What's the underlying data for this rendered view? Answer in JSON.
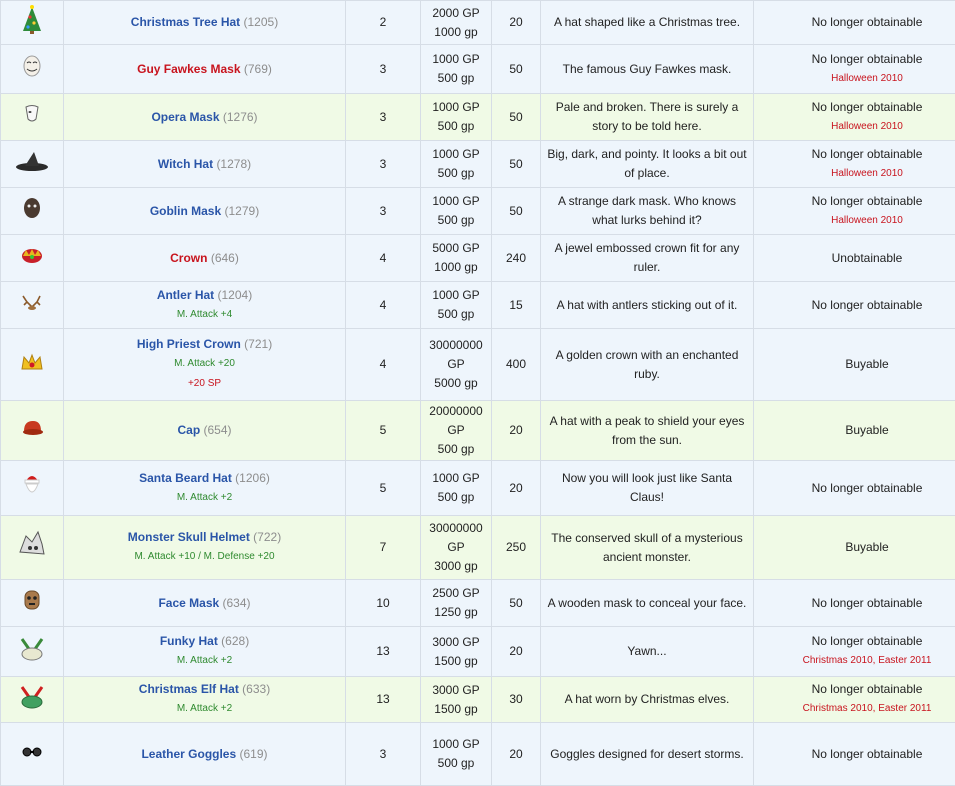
{
  "items": [
    {
      "icon": "christmas-tree-hat-icon",
      "name": "Christmas Tree Hat",
      "id": "(1205)",
      "level": "2",
      "gp": "2000 GP",
      "gp_sell": "1000 gp",
      "sell": "20",
      "desc": "A hat shaped like a Christmas tree.",
      "obtain": "No longer obtainable",
      "note": "",
      "stats": []
    },
    {
      "icon": "guy-fawkes-mask-icon",
      "name": "Guy Fawkes Mask",
      "id": "(769)",
      "level": "3",
      "gp": "1000 GP",
      "gp_sell": "500 gp",
      "sell": "50",
      "desc": "The famous Guy Fawkes mask.",
      "obtain": "No longer obtainable",
      "note": "Halloween 2010",
      "stats": []
    },
    {
      "icon": "opera-mask-icon",
      "name": "Opera Mask",
      "id": "(1276)",
      "level": "3",
      "gp": "1000 GP",
      "gp_sell": "500 gp",
      "sell": "50",
      "desc": "Pale and broken. There is surely a story to be told here.",
      "obtain": "No longer obtainable",
      "note": "Halloween 2010",
      "stats": []
    },
    {
      "icon": "witch-hat-icon",
      "name": "Witch Hat",
      "id": "(1278)",
      "level": "3",
      "gp": "1000 GP",
      "gp_sell": "500 gp",
      "sell": "50",
      "desc": "Big, dark, and pointy. It looks a bit out of place.",
      "obtain": "No longer obtainable",
      "note": "Halloween 2010",
      "stats": []
    },
    {
      "icon": "goblin-mask-icon",
      "name": "Goblin Mask",
      "id": "(1279)",
      "level": "3",
      "gp": "1000 GP",
      "gp_sell": "500 gp",
      "sell": "50",
      "desc": "A strange dark mask. Who knows what lurks behind it?",
      "obtain": "No longer obtainable",
      "note": "Halloween 2010",
      "stats": []
    },
    {
      "icon": "crown-icon",
      "name": "Crown",
      "id": "(646)",
      "level": "4",
      "gp": "5000 GP",
      "gp_sell": "1000 gp",
      "sell": "240",
      "desc": "A jewel embossed crown fit for any ruler.",
      "obtain": "Unobtainable",
      "note": "",
      "stats": []
    },
    {
      "icon": "antler-hat-icon",
      "name": "Antler Hat",
      "id": "(1204)",
      "level": "4",
      "gp": "1000 GP",
      "gp_sell": "500 gp",
      "sell": "15",
      "desc": "A hat with antlers sticking out of it.",
      "obtain": "No longer obtainable",
      "note": "",
      "stats": [
        {
          "text": "M. Attack +4",
          "sp": false
        }
      ]
    },
    {
      "icon": "high-priest-crown-icon",
      "name": "High Priest Crown",
      "id": "(721)",
      "level": "4",
      "gp": "30000000 GP",
      "gp_sell": "5000 gp",
      "sell": "400",
      "desc": "A golden crown with an enchanted ruby.",
      "obtain": "Buyable",
      "note": "",
      "stats": [
        {
          "text": "M. Attack +20",
          "sp": false
        },
        {
          "text": "+20 SP",
          "sp": true
        }
      ]
    },
    {
      "icon": "cap-icon",
      "name": "Cap",
      "id": "(654)",
      "level": "5",
      "gp": "20000000 GP",
      "gp_sell": "500 gp",
      "sell": "20",
      "desc": "A hat with a peak to shield your eyes from the sun.",
      "obtain": "Buyable",
      "note": "",
      "stats": []
    },
    {
      "icon": "santa-beard-hat-icon",
      "name": "Santa Beard Hat",
      "id": "(1206)",
      "level": "5",
      "gp": "1000 GP",
      "gp_sell": "500 gp",
      "sell": "20",
      "desc": "Now you will look just like Santa Claus!",
      "obtain": "No longer obtainable",
      "note": "",
      "stats": [
        {
          "text": "M. Attack +2",
          "sp": false
        }
      ]
    },
    {
      "icon": "monster-skull-helmet-icon",
      "name": "Monster Skull Helmet",
      "id": "(722)",
      "level": "7",
      "gp": "30000000 GP",
      "gp_sell": "3000 gp",
      "sell": "250",
      "desc": "The conserved skull of a mysterious ancient monster.",
      "obtain": "Buyable",
      "note": "",
      "stats": [
        {
          "text": "M. Attack +10 / M. Defense +20",
          "sp": false
        }
      ]
    },
    {
      "icon": "face-mask-icon",
      "name": "Face Mask",
      "id": "(634)",
      "level": "10",
      "gp": "2500 GP",
      "gp_sell": "1250 gp",
      "sell": "50",
      "desc": "A wooden mask to conceal your face.",
      "obtain": "No longer obtainable",
      "note": "",
      "stats": []
    },
    {
      "icon": "funky-hat-icon",
      "name": "Funky Hat",
      "id": "(628)",
      "level": "13",
      "gp": "3000 GP",
      "gp_sell": "1500 gp",
      "sell": "20",
      "desc": "Yawn...",
      "obtain": "No longer obtainable",
      "note": "Christmas 2010, Easter 2011",
      "stats": [
        {
          "text": "M. Attack +2",
          "sp": false
        }
      ]
    },
    {
      "icon": "christmas-elf-hat-icon",
      "name": "Christmas Elf Hat",
      "id": "(633)",
      "level": "13",
      "gp": "3000 GP",
      "gp_sell": "1500 gp",
      "sell": "30",
      "desc": "A hat worn by Christmas elves.",
      "obtain": "No longer obtainable",
      "note": "Christmas 2010, Easter 2011",
      "stats": [
        {
          "text": "M. Attack +2",
          "sp": false
        }
      ]
    },
    {
      "icon": "leather-goggles-icon",
      "name": "Leather Goggles",
      "id": "(619)",
      "level": "3",
      "gp": "1000 GP",
      "gp_sell": "500 gp",
      "sell": "20",
      "desc": "Goggles designed for desert storms.",
      "obtain": "No longer obtainable",
      "note": "",
      "stats": []
    }
  ],
  "colors": {
    "row_blue": "#eef5fc",
    "row_green": "#f0fae6",
    "name_blue": "#2a55a8",
    "name_red": "#c8141e",
    "stat_green": "#2f8a2f"
  }
}
